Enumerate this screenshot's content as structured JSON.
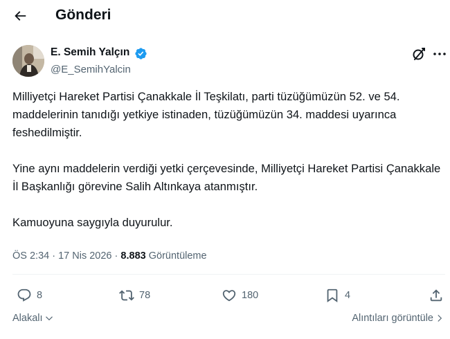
{
  "header": {
    "title": "Gönderi",
    "back_icon": "arrow-left-icon"
  },
  "author": {
    "display_name": "E. Semih Yalçın",
    "handle": "@E_SemihYalcin",
    "verified": true,
    "verified_color": "#1d9bf0",
    "avatar": "profile-photo"
  },
  "tweet": {
    "paragraphs": [
      "Milliyetçi Hareket Partisi Çanakkale İl Teşkilatı, parti tüzüğümüzün 52. ve 54. maddelerinin tanıdığı yetkiye istinaden, tüzüğümüzün 34. maddesi uyarınca feshedilmiştir.",
      "Yine aynı maddelerin verdiği yetki çerçevesinde, Milliyetçi Hareket Partisi Çanakkale İl Başkanlığı görevine Salih Altınkaya atanmıştır.",
      "Kamuoyuna saygıyla duyurulur."
    ]
  },
  "meta": {
    "time": "ÖS 2:34",
    "separator": "·",
    "date": "17 Nis 2026",
    "views_count": "8.883",
    "views_label": "Görüntüleme"
  },
  "actions": {
    "replies": "8",
    "reposts": "78",
    "likes": "180",
    "bookmarks": "4"
  },
  "footer": {
    "related_label": "Alakalı",
    "quotes_label": "Alıntıları görüntüle"
  },
  "colors": {
    "text": "#0f1419",
    "secondary": "#536471",
    "divider": "#eff3f4"
  }
}
